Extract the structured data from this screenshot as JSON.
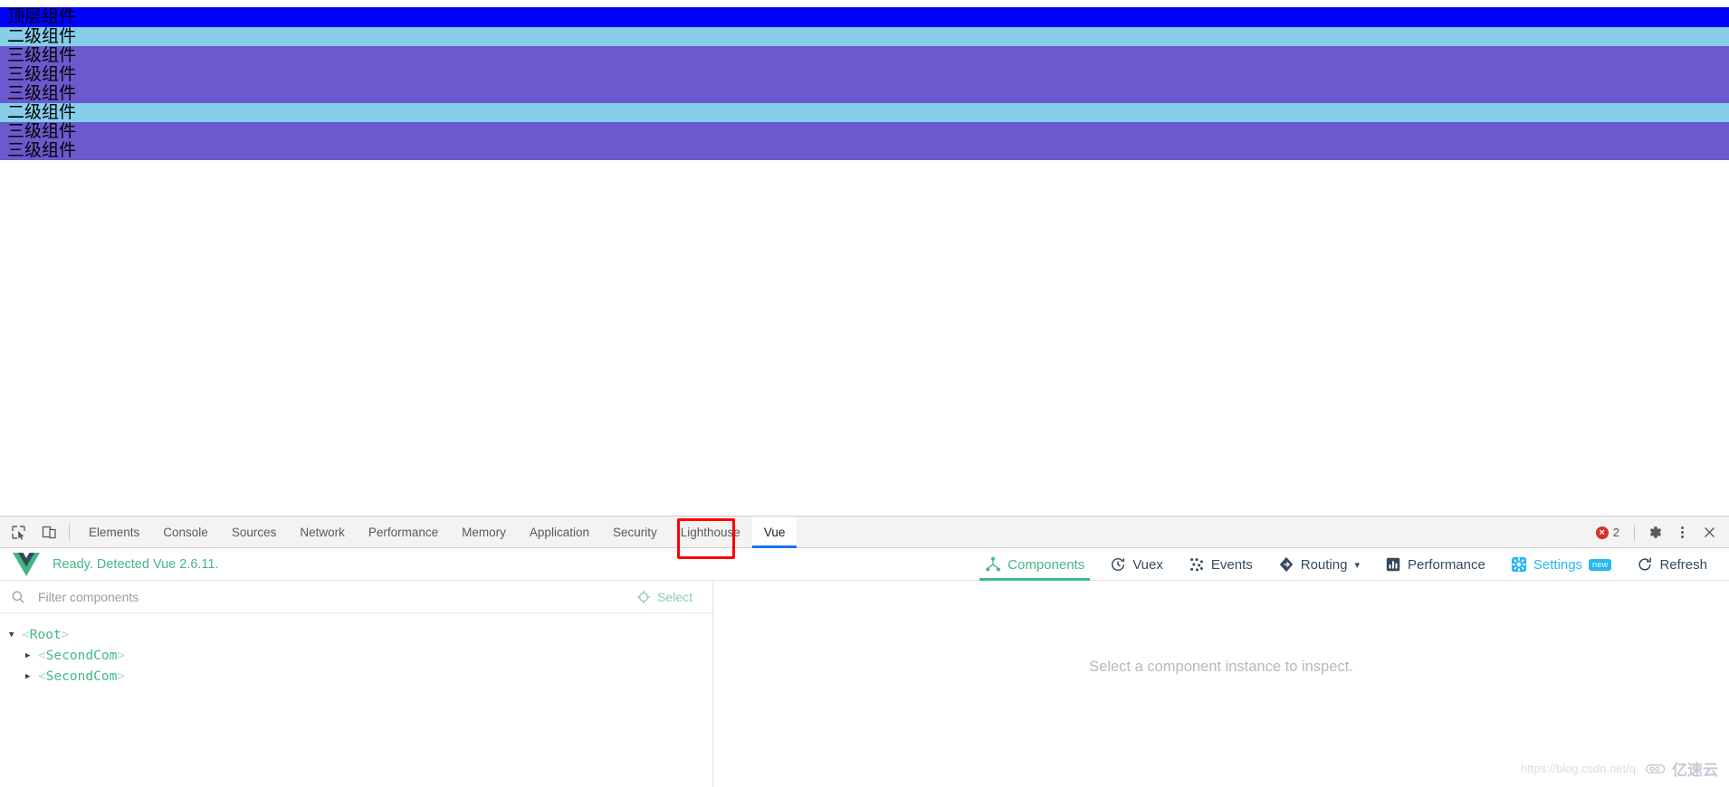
{
  "page": {
    "rows": [
      {
        "label": "顶层组件",
        "level": "top"
      },
      {
        "label": "二级组件",
        "level": "two"
      },
      {
        "label": "三级组件",
        "level": "three"
      },
      {
        "label": "三级组件",
        "level": "three"
      },
      {
        "label": "三级组件",
        "level": "three"
      },
      {
        "label": "二级组件",
        "level": "two"
      },
      {
        "label": "三级组件",
        "level": "three"
      },
      {
        "label": "三级组件",
        "level": "three"
      }
    ],
    "colors": {
      "top": "#0000ff",
      "two": "#87ceeb",
      "three": "#6a5acd"
    }
  },
  "devtools": {
    "tabs": [
      {
        "label": "Elements",
        "active": false
      },
      {
        "label": "Console",
        "active": false
      },
      {
        "label": "Sources",
        "active": false
      },
      {
        "label": "Network",
        "active": false
      },
      {
        "label": "Performance",
        "active": false
      },
      {
        "label": "Memory",
        "active": false
      },
      {
        "label": "Application",
        "active": false
      },
      {
        "label": "Security",
        "active": false
      },
      {
        "label": "Lighthouse",
        "active": false
      },
      {
        "label": "Vue",
        "active": true
      }
    ],
    "error_count": "2",
    "highlight_color": "#ff0000",
    "active_tab_underline": "#1a73e8"
  },
  "vue_panel": {
    "status": "Ready. Detected Vue 2.6.11.",
    "status_color": "#42b983",
    "nav": [
      {
        "label": "Components",
        "icon": "components-icon",
        "active": true
      },
      {
        "label": "Vuex",
        "icon": "vuex-icon",
        "active": false
      },
      {
        "label": "Events",
        "icon": "events-icon",
        "active": false
      },
      {
        "label": "Routing",
        "icon": "routing-icon",
        "active": false,
        "chevron": "▾"
      },
      {
        "label": "Performance",
        "icon": "performance-icon",
        "active": false
      },
      {
        "label": "Settings",
        "icon": "settings-icon",
        "active": false,
        "badge": "new"
      },
      {
        "label": "Refresh",
        "icon": "refresh-icon",
        "active": false
      }
    ],
    "filter": {
      "placeholder": "Filter components",
      "value": ""
    },
    "select_button": "Select",
    "tree": [
      {
        "name": "Root",
        "depth": 0,
        "triangle": "▼"
      },
      {
        "name": "SecondCom",
        "depth": 1,
        "triangle": "▶"
      },
      {
        "name": "SecondCom",
        "depth": 1,
        "triangle": "▶"
      }
    ],
    "detail_placeholder": "Select a component instance to inspect."
  },
  "watermark": {
    "url": "https://blog.csdn.net/q",
    "brand": "亿速云"
  }
}
